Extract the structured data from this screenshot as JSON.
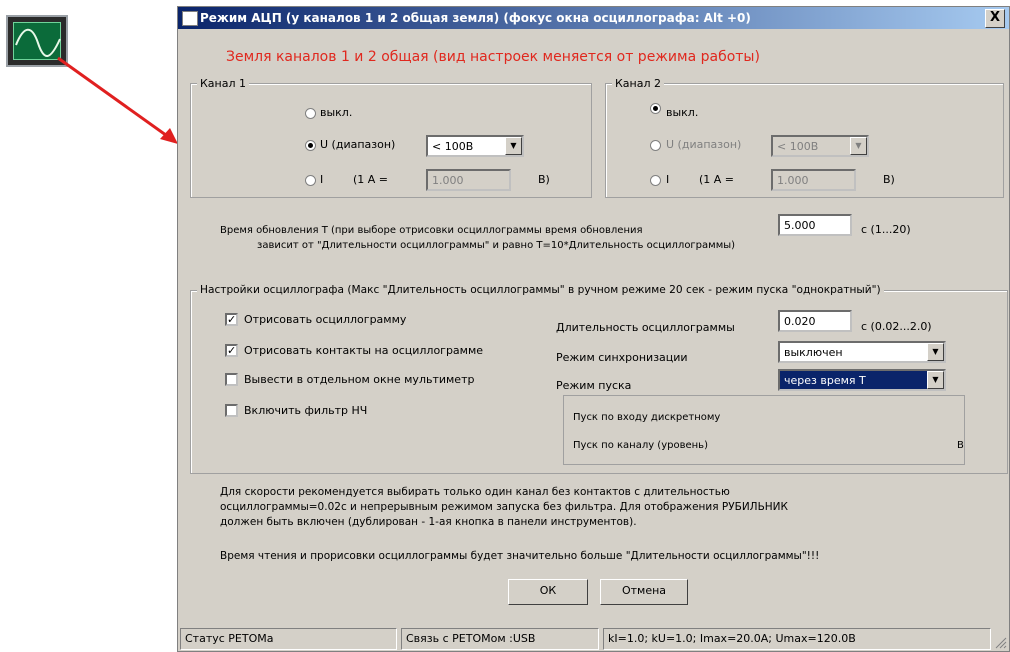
{
  "dialog": {
    "title": "Режим АЦП (у каналов 1 и 2 общая земля)  (фокус окна осциллографа:  Alt +0)",
    "close": "X",
    "warning": "Земля каналов 1 и 2 общая (вид настроек меняется от режима работы)"
  },
  "channel1": {
    "legend": "Канал 1",
    "off_label": "выкл.",
    "u_label": "U (диапазон)",
    "u_range": "< 100В",
    "i_label": "I",
    "ratio_prefix": "(1 А =",
    "ratio_value": "1.000",
    "ratio_suffix": "В)"
  },
  "channel2": {
    "legend": "Канал 2",
    "off_label": "выкл.",
    "u_label": "U (диапазон)",
    "u_range": "< 100В",
    "i_label": "I",
    "ratio_prefix": "(1 А =",
    "ratio_value": "1.000",
    "ratio_suffix": "В)"
  },
  "update": {
    "line1": "Время обновления Т (при выборе отрисовки осциллограммы время обновления",
    "line2": "зависит от \"Длительности осциллограммы\" и равно Т=10*Длительность осциллограммы)",
    "value": "5.000",
    "unit": "с  (1...20)"
  },
  "osc": {
    "legend": "Настройки осциллографа (Макс \"Длительность осциллограммы\" в ручном режиме 20 сек - режим пуска \"однократный\")",
    "cb1": "Отрисовать осциллограмму",
    "cb2": "Отрисовать контакты на осциллограмме",
    "cb3": "Вывести в отдельном окне мультиметр",
    "cb4": "Включить фильтр НЧ",
    "duration_label": "Длительность осциллограммы",
    "duration_value": "0.020",
    "duration_unit": "с  (0.02...2.0)",
    "sync_label": "Режим синхронизации",
    "sync_value": "выключен",
    "start_label": "Режим пуска",
    "start_value": "через время Т",
    "start_opt1": "Пуск по входу дискретному",
    "start_opt2": "Пуск по каналу (уровень)",
    "start_opt2_unit": "В"
  },
  "note": {
    "line1": "Для скорости рекомендуется выбирать только один канал без контактов с длительностью",
    "line2": "осциллограммы=0.02с и непрерывным режимом запуска без фильтра. Для отображения РУБИЛЬНИК",
    "line3": "должен быть включен (дублирован - 1-ая кнопка в панели инструментов).",
    "line4": "Время чтения и прорисовки осциллограммы будет значительно больше \"Длительности осциллограммы\"!!!"
  },
  "buttons": {
    "ok": "ОК",
    "cancel": "Отмена"
  },
  "statusbar": {
    "s1": "Статус РЕТОМа",
    "s2": "Связь с РЕТОМом :USB",
    "s3": "kI=1.0; kU=1.0; Imax=20.0А; Umax=120.0В"
  },
  "colors": {
    "warning": "#e0281e",
    "title_start": "#0a246a",
    "arrow": "#e02020"
  }
}
